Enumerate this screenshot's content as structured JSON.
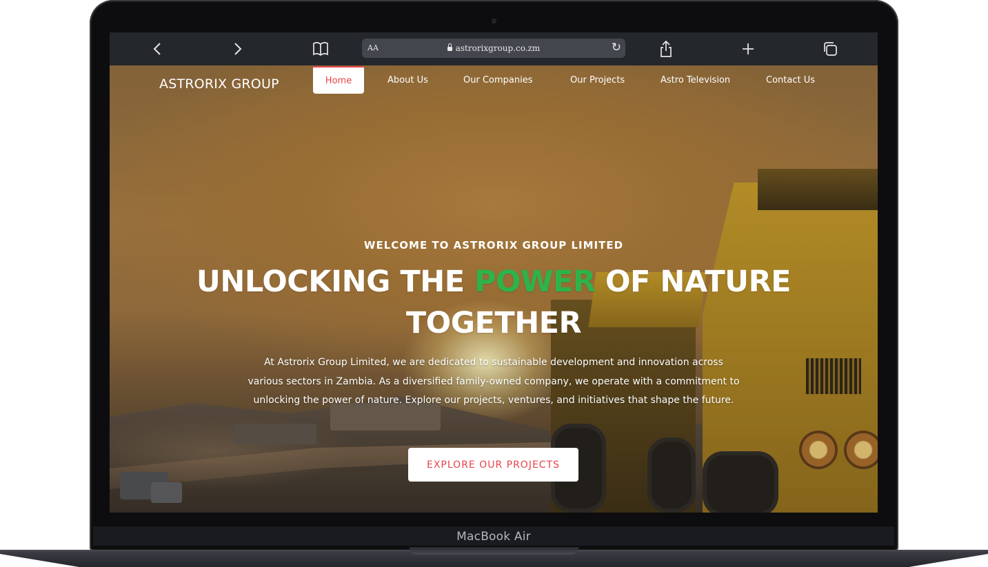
{
  "device": {
    "label": "MacBook Air"
  },
  "browser": {
    "text_size_label": "AA",
    "url": "astrorixgroup.co.zm",
    "icons": [
      "back-icon",
      "forward-icon",
      "bookmarks-icon",
      "lock-icon",
      "reload-icon",
      "share-icon",
      "new-tab-icon",
      "tabs-icon"
    ]
  },
  "site": {
    "brand": "ASTRORIX GROUP",
    "nav": [
      {
        "label": "Home",
        "active": true
      },
      {
        "label": "About Us"
      },
      {
        "label": "Our Companies"
      },
      {
        "label": "Our Projects"
      },
      {
        "label": "Astro Television"
      },
      {
        "label": "Contact Us"
      }
    ],
    "hero": {
      "eyebrow": "WELCOME TO ASTRORIX GROUP LIMITED",
      "headline_before": "UNLOCKING THE ",
      "headline_highlight": "POWER",
      "headline_after": " OF NATURE TOGETHER",
      "description": "At Astrorix Group Limited, we are dedicated to sustainable development and innovation across various sectors in Zambia. As a diversified family-owned company, we operate with a commitment to unlocking the power of nature. Explore our projects, ventures, and initiatives that shape the future.",
      "cta_label": "EXPLORE OUR PROJECTS"
    }
  },
  "colors": {
    "accent_red": "#e8424a",
    "highlight_green": "#2db34a",
    "toolbar_bg": "#24272b"
  }
}
